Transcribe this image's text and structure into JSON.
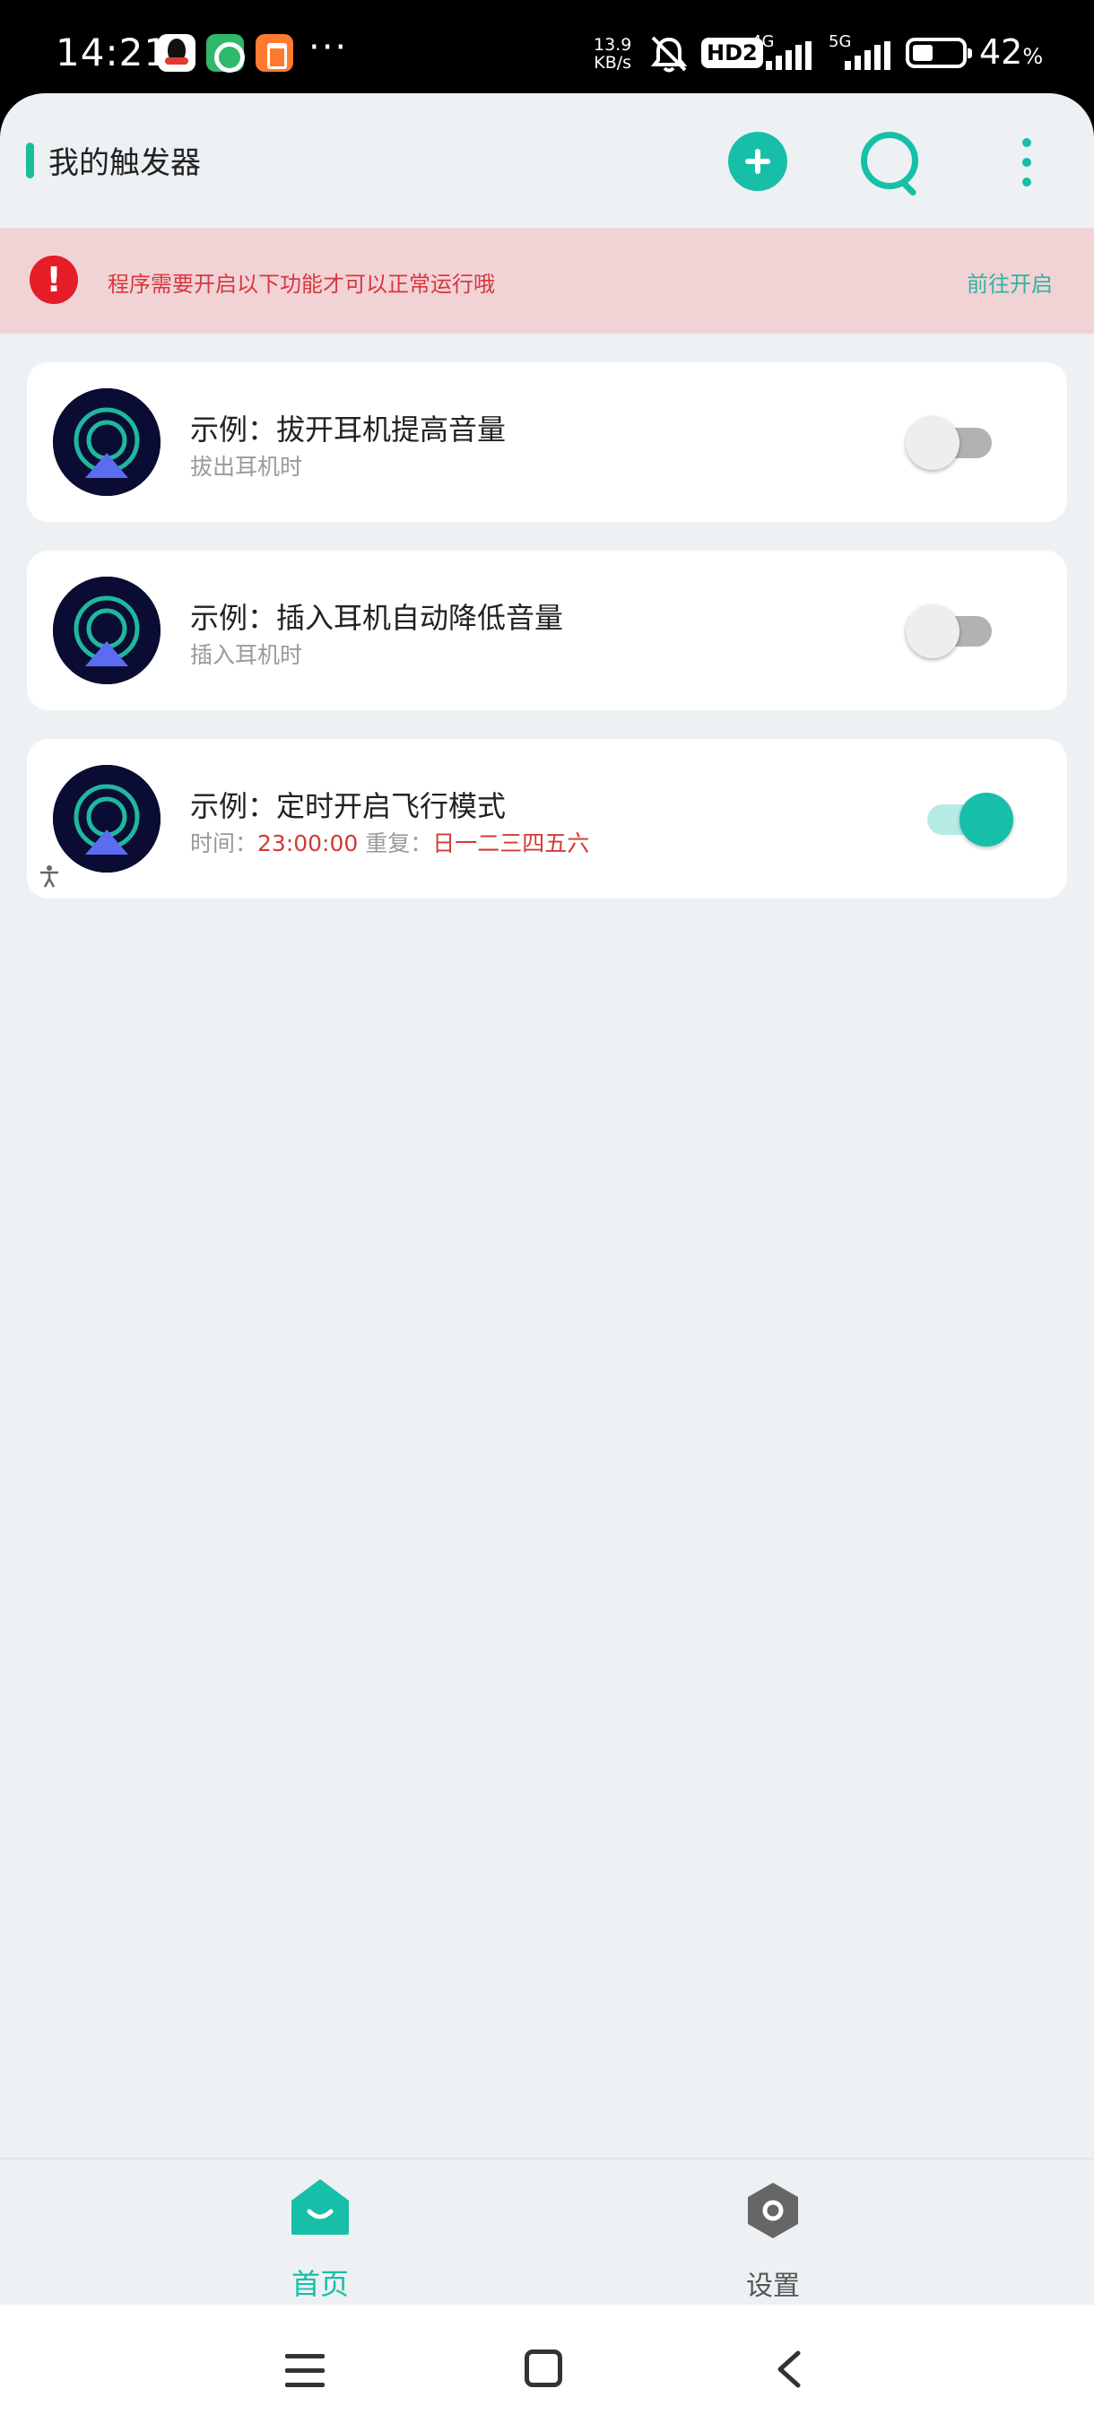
{
  "status_bar": {
    "time": "14:21",
    "speed_value": "13.9",
    "speed_unit": "KB/s",
    "hd_badge": "HD2",
    "net1": "4G",
    "net2": "5G",
    "battery_value": "42",
    "battery_unit": "%",
    "more": "···",
    "battery_level": 0.42
  },
  "header": {
    "title": "我的触发器",
    "add_icon": "plus-circle-icon",
    "search_icon": "search-icon",
    "more_icon": "more-vertical-icon"
  },
  "warning": {
    "text": "程序需要开启以下功能才可以正常运行哦",
    "action": "前往开启"
  },
  "triggers": [
    {
      "title": "示例：拔开耳机提高音量",
      "subtitle": "拔出耳机时",
      "enabled": false
    },
    {
      "title": "示例：插入耳机自动降低音量",
      "subtitle": "插入耳机时",
      "enabled": false
    },
    {
      "title": "示例：定时开启飞行模式",
      "time_label": "时间：",
      "time_value": "23:00:00",
      "repeat_label": "重复：",
      "repeat_value": "日一二三四五六",
      "enabled": true
    }
  ],
  "bottom_nav": {
    "home": "首页",
    "settings": "设置"
  },
  "colors": {
    "accent": "#17bfa8",
    "warning_bg": "#f1d3d6",
    "warning_text": "#d8373f",
    "background": "#edf1f3"
  }
}
